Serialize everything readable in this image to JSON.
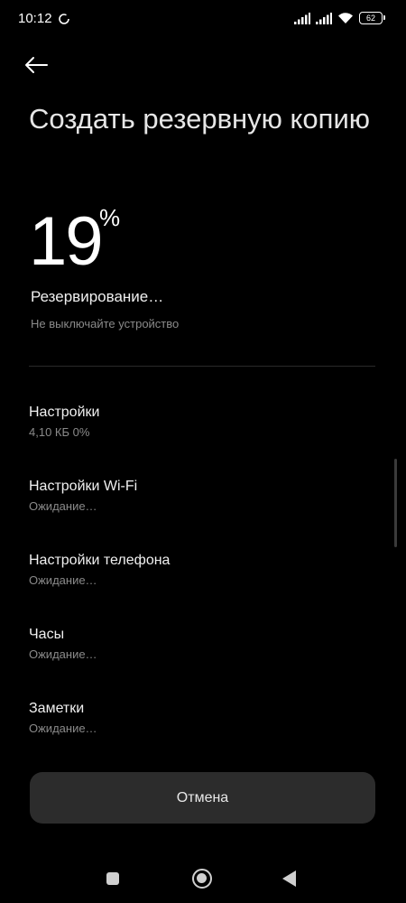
{
  "status_bar": {
    "time": "10:12",
    "battery_level": "62",
    "icons": [
      "sync-icon",
      "signal-icon",
      "signal-icon",
      "wifi-icon",
      "battery-icon"
    ]
  },
  "header": {
    "back_icon": "arrow-left-icon",
    "title": "Создать резервную копию"
  },
  "progress": {
    "value": "19",
    "unit": "%",
    "status": "Резервирование…",
    "hint": "Не выключайте устройство"
  },
  "items": [
    {
      "title": "Настройки",
      "subtitle": "4,10 КБ 0%"
    },
    {
      "title": "Настройки Wi-Fi",
      "subtitle": "Ожидание…"
    },
    {
      "title": "Настройки телефона",
      "subtitle": "Ожидание…"
    },
    {
      "title": "Часы",
      "subtitle": "Ожидание…"
    },
    {
      "title": "Заметки",
      "subtitle": "Ожидание…"
    }
  ],
  "actions": {
    "cancel_label": "Отмена"
  },
  "nav_bar": {
    "icons": [
      "recent-apps-icon",
      "home-icon",
      "back-icon"
    ]
  },
  "colors": {
    "background": "#000000",
    "button_bg": "#2c2c2c",
    "secondary_text": "#8a8a8a"
  }
}
